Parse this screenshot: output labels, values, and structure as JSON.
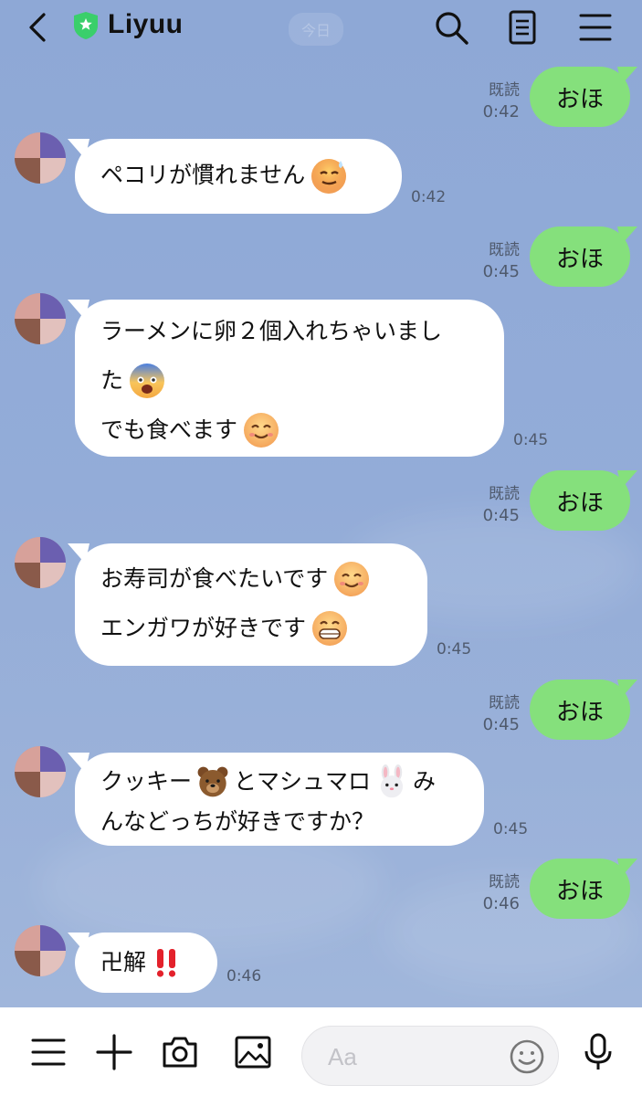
{
  "header": {
    "name": "Liyuu",
    "date_chip": "今日",
    "icons": [
      "back-icon",
      "verified-shield-icon",
      "search-icon",
      "notes-icon",
      "menu-icon"
    ]
  },
  "messages": [
    {
      "type": "sent",
      "text": "おほ",
      "read": "既読",
      "time": "0:42"
    },
    {
      "type": "received",
      "lines": [
        {
          "text": "ペコリが慣れません",
          "emoji": "sweat-smile-emoji"
        }
      ],
      "time": "0:42"
    },
    {
      "type": "sent",
      "text": "おほ",
      "read": "既読",
      "time": "0:45"
    },
    {
      "type": "received",
      "lines": [
        {
          "text": "ラーメンに卵２個入れちゃいまし"
        },
        {
          "text": "た",
          "emoji": "scared-emoji"
        },
        {
          "text": "でも食べます",
          "emoji": "yummy-emoji"
        }
      ],
      "time": "0:45"
    },
    {
      "type": "sent",
      "text": "おほ",
      "read": "既読",
      "time": "0:45"
    },
    {
      "type": "received",
      "lines": [
        {
          "text": "お寿司が食べたいです",
          "emoji": "yummy-emoji"
        },
        {
          "text": "エンガワが好きです",
          "emoji": "grin-emoji"
        }
      ],
      "time": "0:45"
    },
    {
      "type": "sent",
      "text": "おほ",
      "read": "既読",
      "time": "0:45"
    },
    {
      "type": "received",
      "lines": [
        {
          "text_parts": [
            "クッキー",
            "とマシュマロ",
            "み"
          ],
          "emojis": [
            "bear-emoji",
            "rabbit-emoji"
          ]
        },
        {
          "text": "んなどっちが好きですか？"
        }
      ],
      "time": "0:45"
    },
    {
      "type": "sent",
      "text": "おほ",
      "read": "既読",
      "time": "0:46"
    },
    {
      "type": "received",
      "lines": [
        {
          "text": "卍解",
          "emoji": "double-exclamation-emoji"
        }
      ],
      "time": "0:46"
    }
  ],
  "input": {
    "placeholder": "Aa"
  },
  "colors": {
    "sent_bubble": "#85e07c",
    "received_bubble": "#ffffff",
    "background": "#93acd8",
    "verified": "#3acf6b"
  }
}
